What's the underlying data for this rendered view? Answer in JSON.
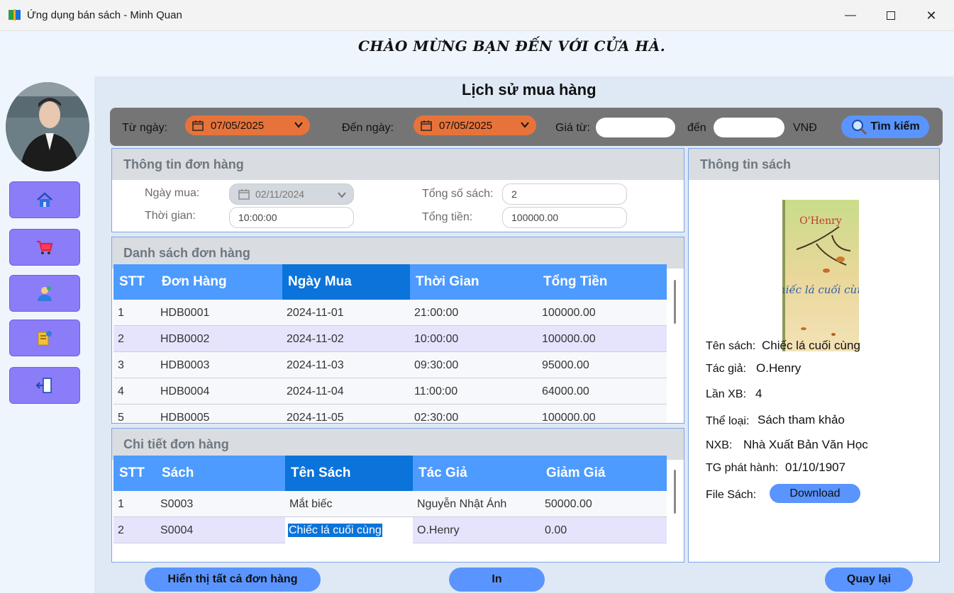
{
  "window": {
    "title": "Ứng dụng bán sách - Minh Quan",
    "minimize": "—",
    "close": "✕"
  },
  "banner": "CHÀO MỪNG BẠN ĐẾN VỚI CỬA HÀ.",
  "page_title": "Lịch sử mua hàng",
  "sidebar": {
    "items": [
      {
        "icon": "home-icon"
      },
      {
        "icon": "cart-icon"
      },
      {
        "icon": "user-icon"
      },
      {
        "icon": "invoice-icon"
      },
      {
        "icon": "logout-icon"
      }
    ]
  },
  "filter": {
    "from_label": "Từ ngày:",
    "from_date": "07/05/2025",
    "to_label": "Đến ngày:",
    "to_date": "07/05/2025",
    "price_from_label": "Giá từ:",
    "price_from_value": "",
    "price_to_label": "đến",
    "price_to_value": "",
    "currency": "VNĐ",
    "search_label": "Tìm kiếm"
  },
  "order_info": {
    "title": "Thông tin đơn hàng",
    "date_label": "Ngày mua:",
    "date_value": "02/11/2024",
    "time_label": "Thời gian:",
    "time_value": "10:00:00",
    "total_books_label": "Tổng số sách:",
    "total_books_value": "2",
    "total_money_label": "Tổng tiền:",
    "total_money_value": "100000.00"
  },
  "orders": {
    "title": "Danh sách đơn hàng",
    "columns": [
      "STT",
      "Đơn Hàng",
      "Ngày Mua",
      "Thời Gian",
      "Tổng Tiền"
    ],
    "rows": [
      [
        "1",
        "HDB0001",
        "2024-11-01",
        "21:00:00",
        "100000.00"
      ],
      [
        "2",
        "HDB0002",
        "2024-11-02",
        "10:00:00",
        "100000.00"
      ],
      [
        "3",
        "HDB0003",
        "2024-11-03",
        "09:30:00",
        "95000.00"
      ],
      [
        "4",
        "HDB0004",
        "2024-11-04",
        "11:00:00",
        "64000.00"
      ],
      [
        "5",
        "HDB0005",
        "2024-11-05",
        "02:30:00",
        "100000.00"
      ]
    ]
  },
  "order_details": {
    "title": "Chi tiết đơn hàng",
    "columns": [
      "STT",
      "Sách",
      "Tên Sách",
      "Tác Giả",
      "Giảm Giá"
    ],
    "rows": [
      [
        "1",
        "S0003",
        "Mắt biếc",
        "Nguyễn Nhật Ánh",
        "50000.00"
      ],
      [
        "2",
        "S0004",
        "Chiếc lá cuối cùng",
        "O.Henry",
        "0.00"
      ]
    ]
  },
  "book_info": {
    "title": "Thông tin sách",
    "cover": {
      "author": "O'Henry",
      "title": "Chiếc lá cuối cùng"
    },
    "name_label": "Tên sách:",
    "name_value": "Chiếc lá cuối cùng",
    "author_label": "Tác giả:",
    "author_value": "O.Henry",
    "edition_label": "Lần XB:",
    "edition_value": "4",
    "genre_label": "Thể loại:",
    "genre_value": "Sách tham khảo",
    "publisher_label": "NXB:",
    "publisher_value": "Nhà Xuất Bản Văn Học",
    "release_label": "TG phát hành:",
    "release_value": "01/10/1907",
    "file_label": "File Sách:",
    "download_label": "Download"
  },
  "buttons": {
    "show_all": "Hiển thị tất cả đơn hàng",
    "print": "In",
    "back": "Quay lại"
  },
  "colors": {
    "accent_blue": "#5a94ff",
    "date_orange": "#e8733a",
    "sidebar_purple": "#8b7cf8",
    "table_header": "#4d9bff",
    "table_selected_header": "#0b73d9"
  }
}
